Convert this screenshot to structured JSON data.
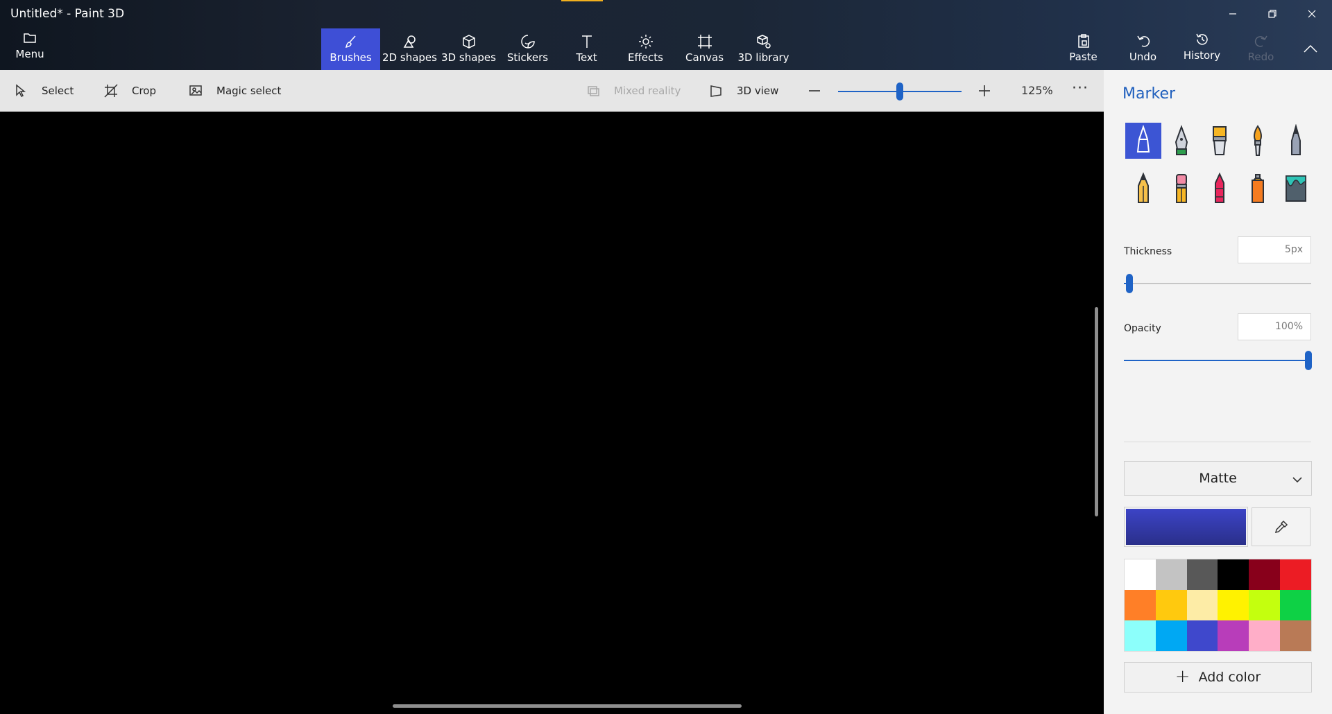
{
  "window": {
    "title": "Untitled* - Paint 3D",
    "minimize_icon": "minimize-icon",
    "restore_icon": "restore-icon",
    "close_icon": "close-icon"
  },
  "ribbon": {
    "menu_label": "Menu",
    "tools": [
      {
        "label": "Brushes",
        "icon": "brush-icon",
        "active": true
      },
      {
        "label": "2D shapes",
        "icon": "2d-shapes-icon"
      },
      {
        "label": "3D shapes",
        "icon": "3d-shapes-icon"
      },
      {
        "label": "Stickers",
        "icon": "stickers-icon"
      },
      {
        "label": "Text",
        "icon": "text-icon"
      },
      {
        "label": "Effects",
        "icon": "effects-icon"
      },
      {
        "label": "Canvas",
        "icon": "canvas-icon"
      },
      {
        "label": "3D library",
        "icon": "3d-library-icon"
      }
    ],
    "actions": [
      {
        "label": "Paste",
        "icon": "paste-icon"
      },
      {
        "label": "Undo",
        "icon": "undo-icon"
      },
      {
        "label": "History",
        "icon": "history-icon"
      },
      {
        "label": "Redo",
        "icon": "redo-icon",
        "disabled": true
      }
    ],
    "accent_color": "#f2b01e",
    "active_color": "#3e4fd6"
  },
  "subbar": {
    "select": "Select",
    "crop": "Crop",
    "magic_select": "Magic select",
    "mixed_reality": "Mixed reality",
    "view_3d": "3D view",
    "zoom_value": "125%",
    "zoom_level_fraction": 0.5,
    "more": "···"
  },
  "panel": {
    "title": "Marker",
    "brushes": [
      "marker",
      "calligraphy-pen",
      "oil-brush",
      "watercolor",
      "pixel-pen",
      "pencil",
      "eraser",
      "crayon",
      "spray-can",
      "fill"
    ],
    "selected_brush": "marker",
    "thickness": {
      "label": "Thickness",
      "value": "5px",
      "fraction": 0.03
    },
    "opacity": {
      "label": "Opacity",
      "value": "100%",
      "fraction": 1.0
    },
    "finish": "Matte",
    "current_color": "#3c44c6",
    "palette": [
      "#ffffff",
      "#c3c3c3",
      "#585858",
      "#000000",
      "#88001b",
      "#ec1c24",
      "#ff7f27",
      "#ffc90e",
      "#fdeca6",
      "#fff200",
      "#c4ff0e",
      "#0ed145",
      "#8cfffb",
      "#00a8f3",
      "#3f48cc",
      "#b83dba",
      "#ffaec8",
      "#b97a56"
    ],
    "add_color": "Add color"
  }
}
